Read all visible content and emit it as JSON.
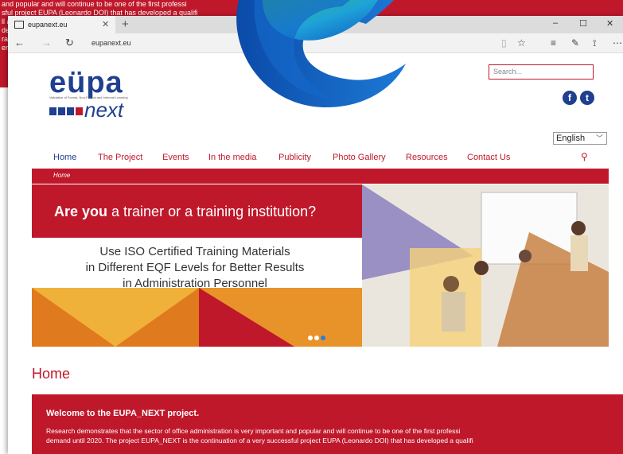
{
  "background_text": {
    "lines": [
      "and popular and will continue to be one of the first professi",
      "sful project EUPA (Leonardo DOI) that has developed a qualifi",
      "ll a",
      "de",
      "rai",
      "ert"
    ]
  },
  "browser": {
    "tab_title": "eupanext.eu",
    "tab_close": "✕",
    "new_tab": "+",
    "url": "eupanext.eu",
    "controls": {
      "minimize": "–",
      "maximize": "☐",
      "close": "✕"
    },
    "nav": {
      "back": "←",
      "forward": "→",
      "refresh": "↻"
    },
    "toolbar": {
      "reading": "▯",
      "favorite": "☆",
      "hub": "≡",
      "note": "✎",
      "share": "⟟",
      "more": "⋯"
    }
  },
  "site": {
    "logo": {
      "eupa": "eüpa",
      "tagline": "Validation of Formal, Non-Formal and Informal Learning",
      "next": "next"
    },
    "search_placeholder": "Search...",
    "social": {
      "facebook": "f",
      "twitter": "t"
    },
    "language": "English",
    "nav": [
      "Home",
      "The Project",
      "Events",
      "In the media",
      "Publicity",
      "Photo Gallery",
      "Resources",
      "Contact Us"
    ],
    "breadcrumb": "Home",
    "banner": {
      "headline_bold": "Are you",
      "headline_rest": " a trainer or a training institution?",
      "sub": [
        "Use ISO Certified Training Materials",
        "in Different EQF Levels for Better Results",
        "in Administration Personnel"
      ]
    },
    "page_title": "Home",
    "welcome_title": "Welcome to the EUPA_NEXT project.",
    "welcome_text": [
      "Research demonstrates that the sector of office administration is very important and popular and will continue to be one of the first professi",
      "demand until 2020. The project  EUPA_NEXT is the continuation of a very successful project EUPA (Leonardo DOI) that has developed a qualifi"
    ]
  },
  "colors": {
    "brand_red": "#c0182b",
    "brand_blue": "#1f3f8f",
    "banner_orange": "#e07a1e"
  }
}
